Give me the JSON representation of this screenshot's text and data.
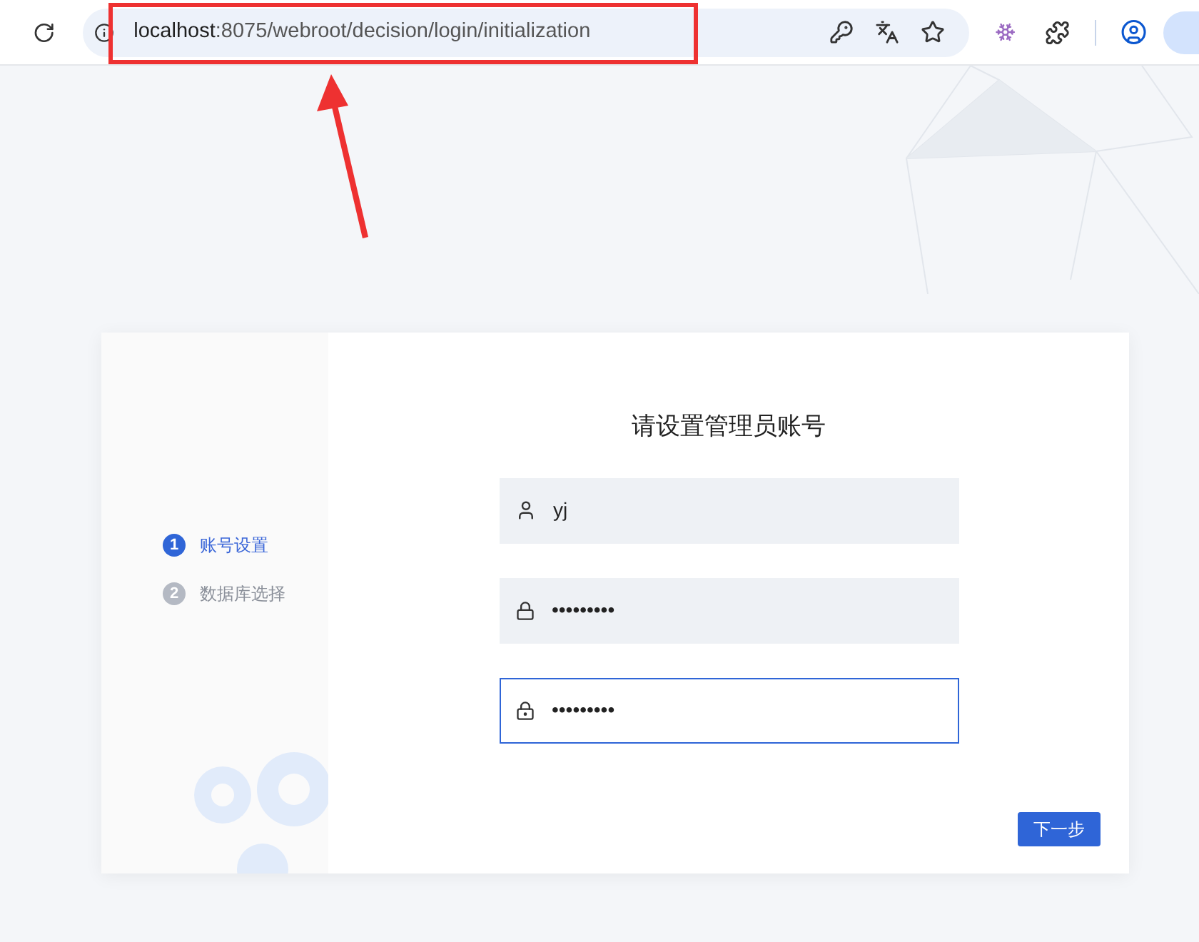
{
  "browser": {
    "url_host": "localhost",
    "url_path": ":8075/webroot/decision/login/initialization"
  },
  "steps": [
    {
      "number": "1",
      "label": "账号设置",
      "selected": true
    },
    {
      "number": "2",
      "label": "数据库选择",
      "selected": false
    }
  ],
  "title": "请设置管理员账号",
  "fields": [
    {
      "kind": "user",
      "value": "yj",
      "focused": false
    },
    {
      "kind": "password",
      "value": "•••••••••",
      "focused": false
    },
    {
      "kind": "confirm",
      "value": "•••••••••",
      "focused": true
    }
  ],
  "next_button": "下一步"
}
